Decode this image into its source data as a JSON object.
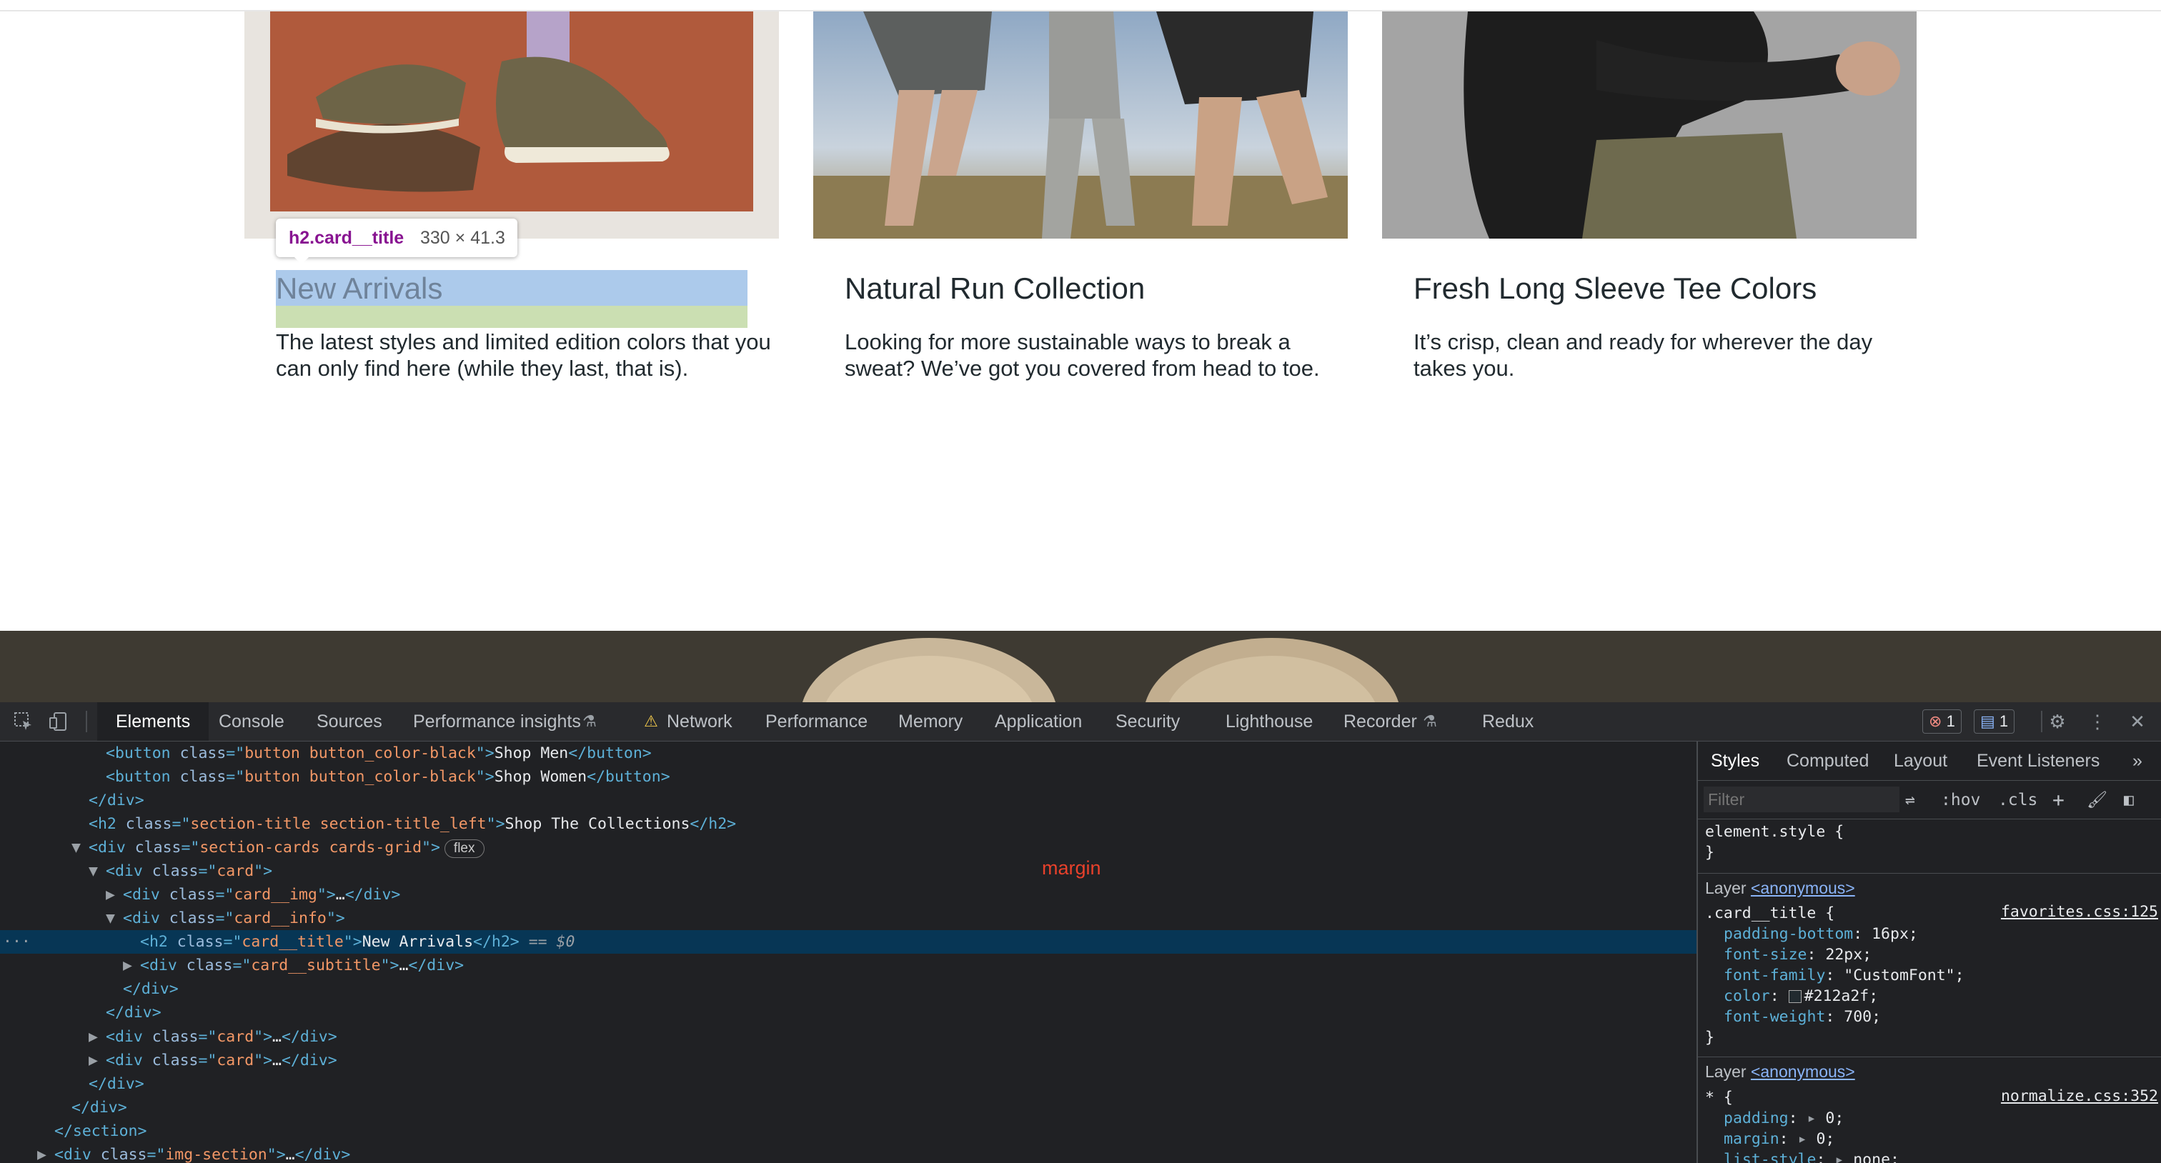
{
  "cards": [
    {
      "title": "New Arrivals",
      "subtitle": "The latest styles and limited edition colors that you can only find here (while they last, that is).",
      "image_icon": "sneakers-photo"
    },
    {
      "title": "Natural Run Collection",
      "subtitle": "Looking for more sustainable ways to break a sweat? We’ve got you covered from head to toe.",
      "image_icon": "runners-photo"
    },
    {
      "title": "Fresh Long Sleeve Tee Colors",
      "subtitle": "It’s crisp, clean and ready for wherever the day takes you.",
      "image_icon": "long-sleeve-tee-photo"
    }
  ],
  "inspect_tooltip": {
    "tag": "h2.card__title",
    "dims": "330 × 41.3"
  },
  "devtools": {
    "tabs": [
      "Elements",
      "Console",
      "Sources",
      "Performance insights",
      "Network",
      "Performance",
      "Memory",
      "Application",
      "Security",
      "Lighthouse",
      "Recorder",
      "Redux"
    ],
    "error_count": "1",
    "message_count": "1",
    "margin_label": "margin",
    "dom": {
      "l1_attr": "button button_color-black",
      "l1_text": "Shop Men",
      "l2_attr": "button button_color-black",
      "l2_text": "Shop Women",
      "l4_attr": "section-title section-title_left",
      "l4_text": "Shop The Collections",
      "l5_attr": "section-cards cards-grid",
      "l5_pill": "flex",
      "l6_attr": "card",
      "l7_attr": "card__img",
      "l8_attr": "card__info",
      "l9_attr": "card__title",
      "l9_text": "New Arrivals",
      "l9_eq": "== $0",
      "l10_attr": "card__subtitle",
      "l13_attr": "card",
      "l14_attr": "card",
      "l18_attr": "img-section"
    },
    "styles": {
      "tabs": [
        "Styles",
        "Computed",
        "Layout",
        "Event Listeners"
      ],
      "filter_placeholder": "Filter",
      "hov": ":hov",
      "cls": ".cls",
      "element_style": "element.style {",
      "layer_label": "Layer",
      "layer_link": "<anonymous>",
      "rule1_selector": ".card__title {",
      "rule1_source": "favorites.css:125",
      "rule1_props": [
        {
          "name": "padding-bottom",
          "value": "16px;"
        },
        {
          "name": "font-size",
          "value": "22px;"
        },
        {
          "name": "font-family",
          "value": "\"CustomFont\";"
        },
        {
          "name": "color",
          "value": "#212a2f;"
        },
        {
          "name": "font-weight",
          "value": "700;"
        }
      ],
      "rule2_selector": "* {",
      "rule2_source": "normalize.css:352",
      "rule2_props": [
        {
          "name": "padding",
          "value": "0;"
        },
        {
          "name": "margin",
          "value": "0;"
        },
        {
          "name": "list-style",
          "value": "none;"
        }
      ]
    }
  }
}
